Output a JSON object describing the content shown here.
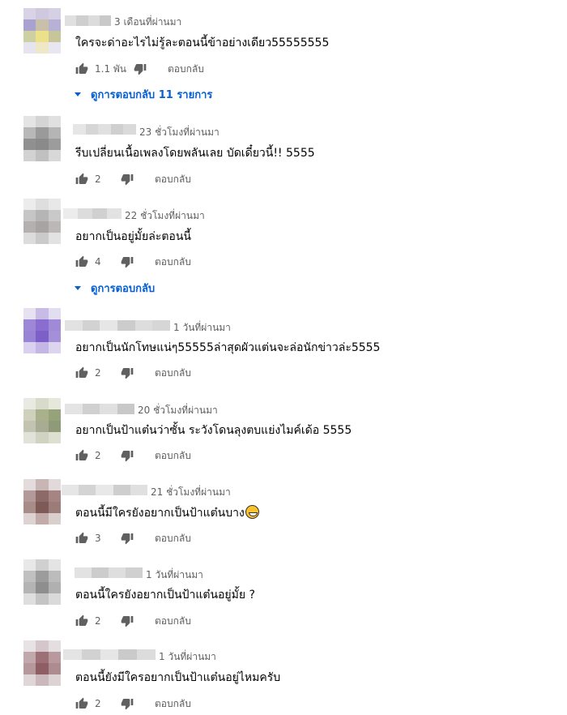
{
  "reply_label": "ตอบกลับ",
  "view_replies_11": "ดูการตอบกลับ 11 รายการ",
  "view_replies": "ดูการตอบกลับ",
  "comments": [
    {
      "time": "3 เดือนที่ผ่านมา",
      "text": "ใครจะด่าอะไรไม่รู้ละตอนนี้ข้าอย่างเดียว55555555",
      "likes": "1.1 พัน"
    },
    {
      "time": "23 ชั่วโมงที่ผ่านมา",
      "text": "รีบเปลี่ยนเนื้อเพลงโดยพลันเลย บัดเดี๋ยวนี้!! 5555",
      "likes": "2"
    },
    {
      "time": "22 ชั่วโมงที่ผ่านมา",
      "text": "อยากเป็นอยู่มั้ยล่ะตอนนี้",
      "likes": "4"
    },
    {
      "time": "1 วันที่ผ่านมา",
      "text": "อยากเป็นนักโทษแน่ๆ55555ล่าสุดผัวแต่นจะล่อนักข่าวล่ะ5555",
      "likes": "2"
    },
    {
      "time": "20 ชั่วโมงที่ผ่านมา",
      "text": "อยากเป็นป้าแต๋นว่าซั้น ระวังโดนลุงตบแย่งไมค์เด้อ 5555",
      "likes": "2"
    },
    {
      "time": "21 ชั่วโมงที่ผ่านมา",
      "text": "ตอนนี้มีใครยังอยากเป็นป้าแต๋นบาง",
      "likes": "3"
    },
    {
      "time": "1 วันที่ผ่านมา",
      "text": "ตอนนี้ใครยังอยากเป็นป้าแต๋นอยู่มั้ย ?",
      "likes": "2"
    },
    {
      "time": "1 วันที่ผ่านมา",
      "text": "ตอนนี้ยังมีใครอยากเป็นป้าแต๋นอยู่ไหมครับ",
      "likes": "2"
    }
  ]
}
